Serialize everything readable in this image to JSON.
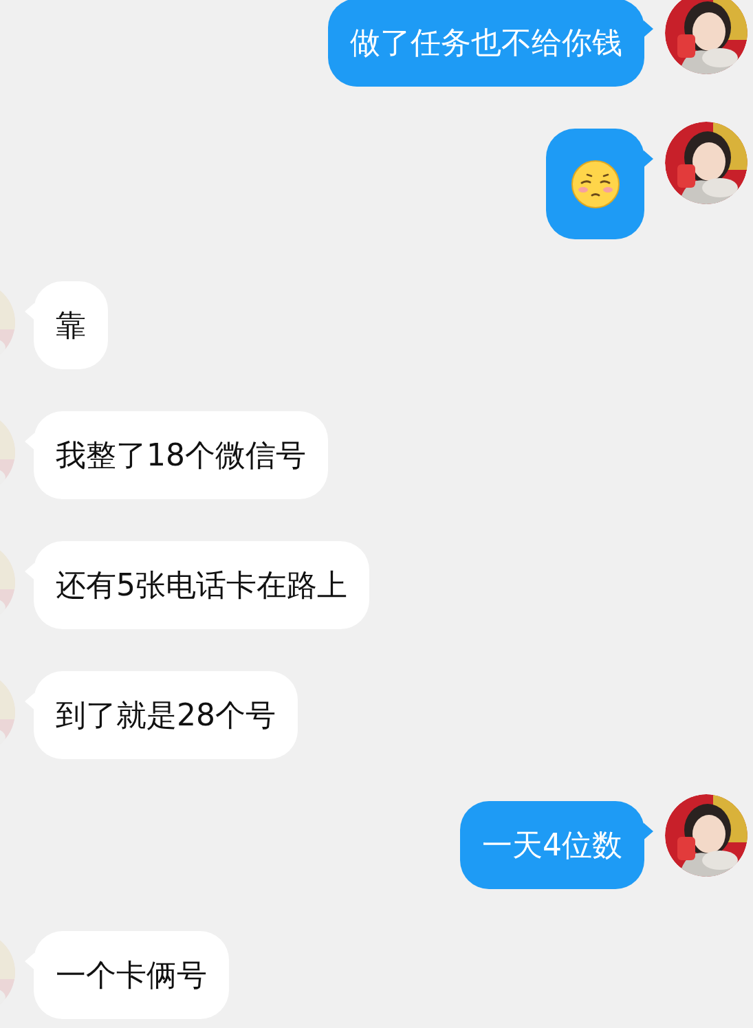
{
  "messages": [
    {
      "from_me": true,
      "kind": "text",
      "text": "做了任务也不给你钱"
    },
    {
      "from_me": true,
      "kind": "emoji"
    },
    {
      "from_me": false,
      "kind": "text",
      "text": "靠"
    },
    {
      "from_me": false,
      "kind": "text",
      "text": "我整了18个微信号"
    },
    {
      "from_me": false,
      "kind": "text",
      "text": "还有5张电话卡在路上"
    },
    {
      "from_me": false,
      "kind": "text",
      "text": "到了就是28个号"
    },
    {
      "from_me": true,
      "kind": "text",
      "text": "一天4位数"
    },
    {
      "from_me": false,
      "kind": "text",
      "text": "一个卡俩号"
    }
  ]
}
